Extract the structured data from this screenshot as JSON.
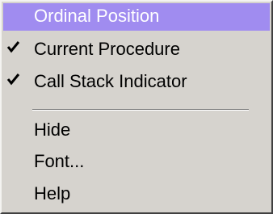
{
  "menu": {
    "items": [
      {
        "label": "Ordinal Position",
        "checked": false,
        "selected": true
      },
      {
        "label": "Current Procedure",
        "checked": true,
        "selected": false
      },
      {
        "label": "Call Stack Indicator",
        "checked": true,
        "selected": false
      },
      {
        "label": "Hide",
        "checked": false,
        "selected": false
      },
      {
        "label": "Font...",
        "checked": false,
        "selected": false
      },
      {
        "label": "Help",
        "checked": false,
        "selected": false
      }
    ]
  },
  "colors": {
    "menu_background": "#d6d3ce",
    "selection_background": "#a08cf0",
    "selection_text": "#ffffff",
    "text": "#000000"
  },
  "icons": {
    "check": "check-icon"
  }
}
